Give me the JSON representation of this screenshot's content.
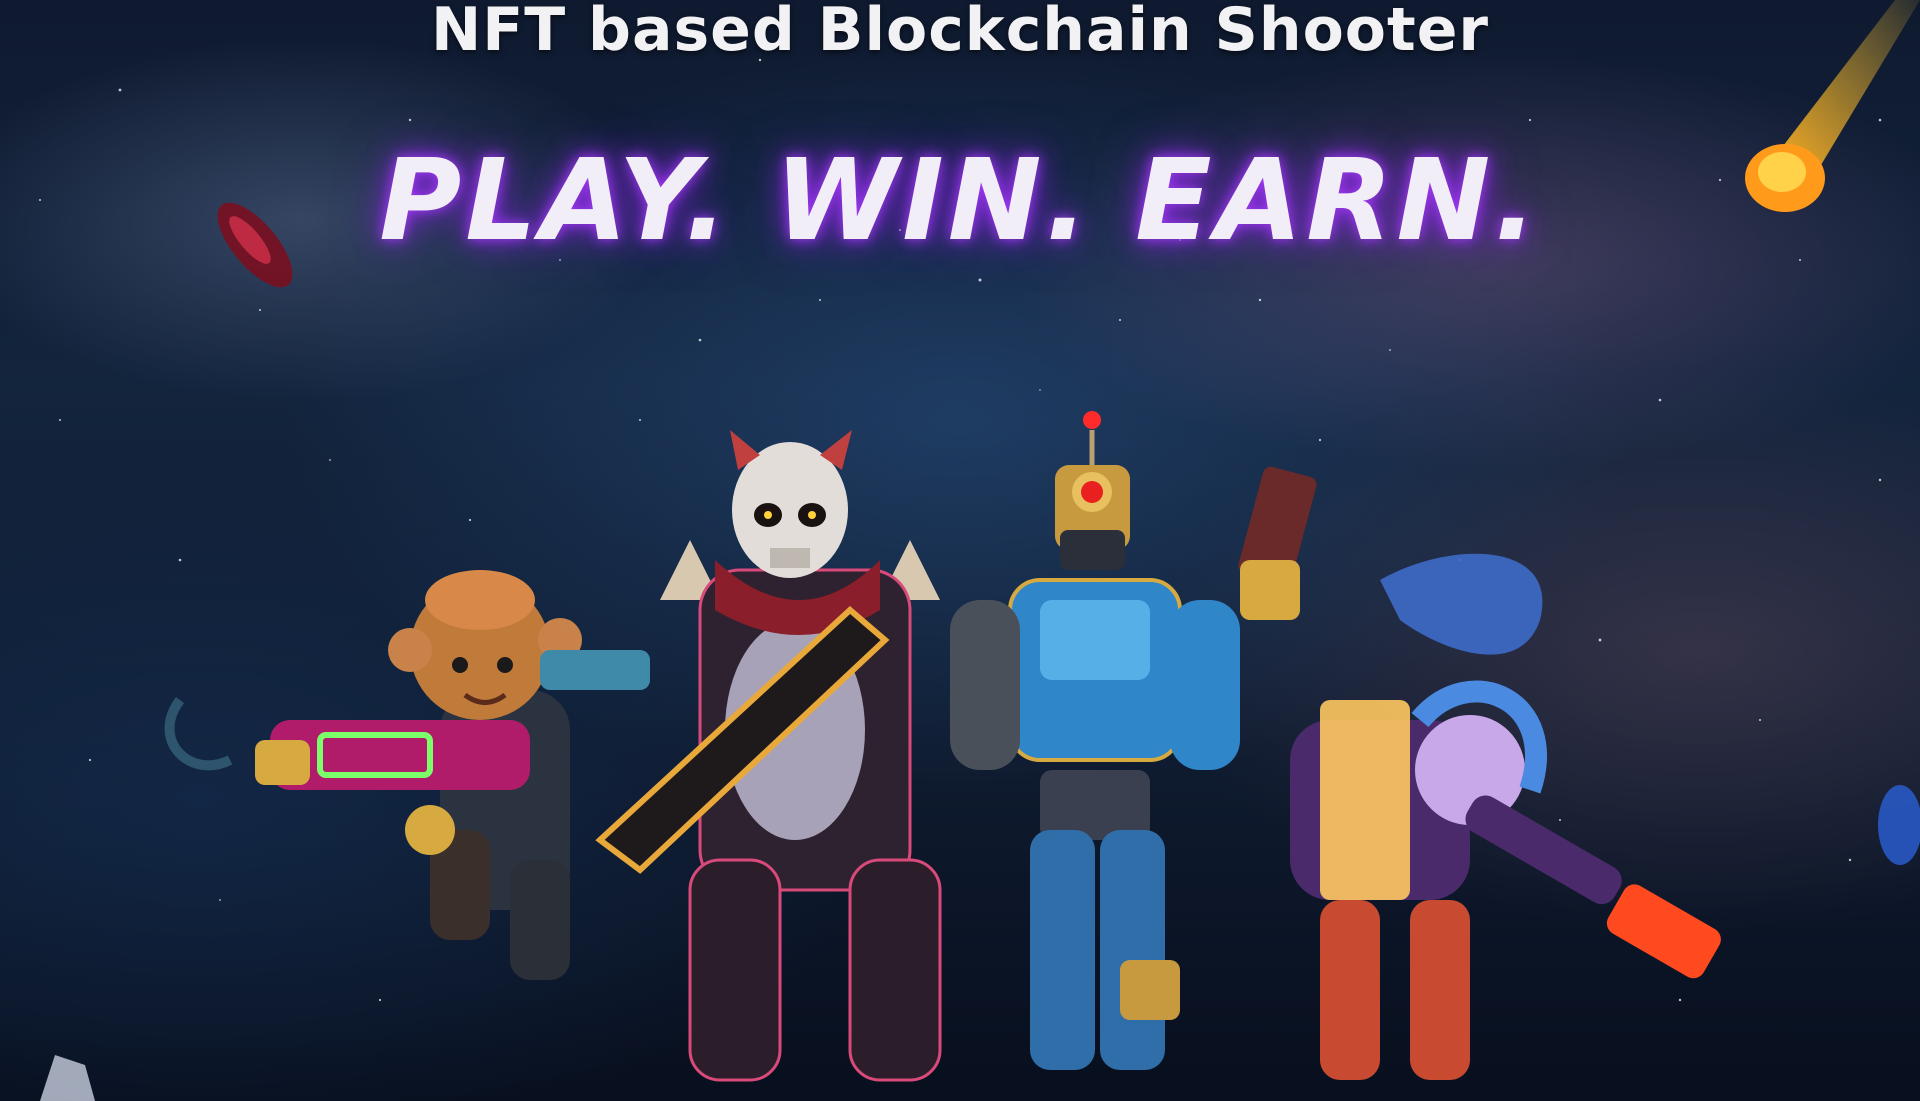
{
  "hero": {
    "subtitle": "NFT based Blockchain Shooter",
    "tagline": "PLAY. WIN. EARN."
  },
  "characters": [
    {
      "name": "monkey-gunner"
    },
    {
      "name": "skull-warrior"
    },
    {
      "name": "blue-robot"
    },
    {
      "name": "blue-haired-heroine"
    }
  ],
  "colors": {
    "background": "#0f1a30",
    "tagline_glow": "#a03cff",
    "text": "#f2f2f4"
  }
}
